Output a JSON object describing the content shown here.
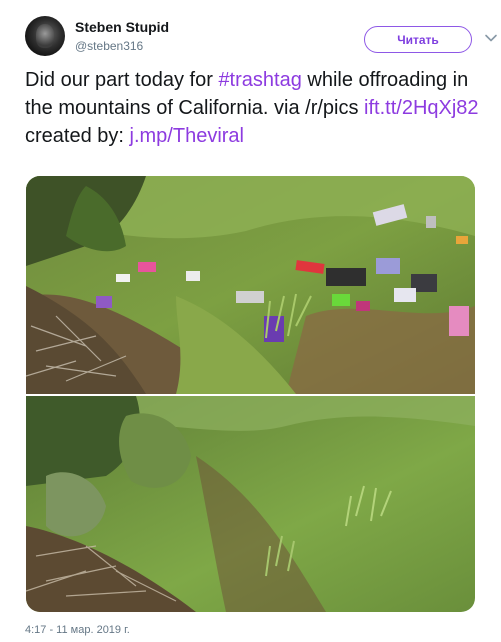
{
  "user": {
    "name": "Steben Stupid",
    "handle": "@steben316",
    "avatar_icon": "user-avatar-icon"
  },
  "follow_button": {
    "label": "Читать"
  },
  "menu_icon": "chevron-down-icon",
  "tweet": {
    "text_plain_1": "Did our part today for ",
    "hashtag": "#trashtag",
    "text_plain_2": " while offroading in the mountains of California. via /r/pics ",
    "link_1": "ift.tt/2HqXj82",
    "text_plain_3": " created by: ",
    "link_2": "j.mp/Theviral"
  },
  "timestamp": "4:17 - 11 мар. 2019 г.",
  "colors": {
    "link": "#8d3be0",
    "follow_border": "#8e58e6",
    "secondary_text": "#657786"
  }
}
